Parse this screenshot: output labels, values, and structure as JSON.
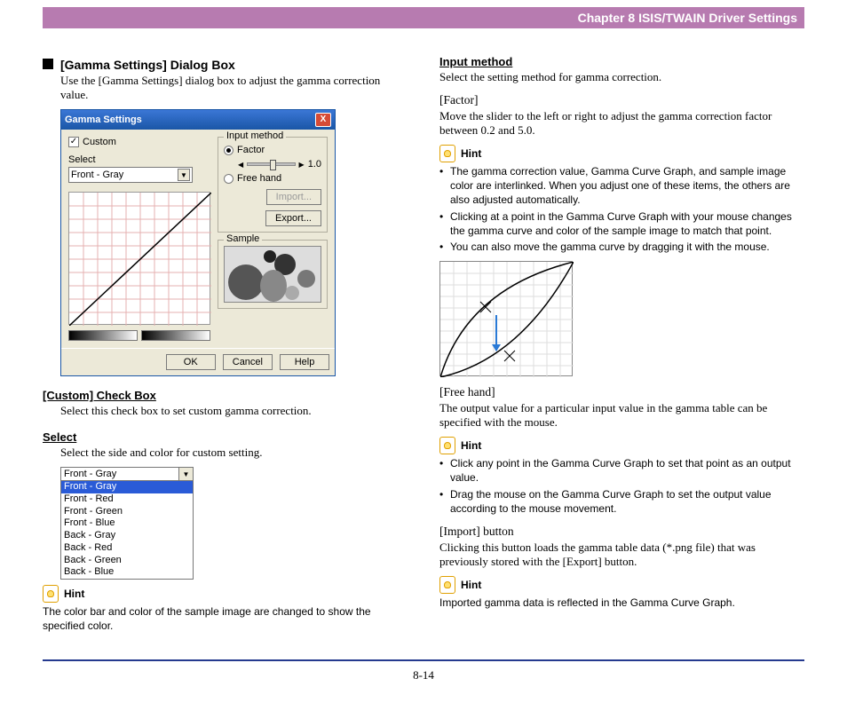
{
  "header": {
    "chapter": "Chapter 8   ISIS/TWAIN Driver Settings"
  },
  "left": {
    "h_main": "[Gamma Settings] Dialog Box",
    "intro": "Use the [Gamma Settings] dialog box to adjust the gamma correction value.",
    "dialog": {
      "title": "Gamma Settings",
      "close": "X",
      "custom_chk": "✓",
      "custom_label": "Custom",
      "select_label": "Select",
      "select_value": "Front - Gray",
      "input_method_legend": "Input method",
      "factor_label": "Factor",
      "freehand_label": "Free hand",
      "factor_value": "1.0",
      "import_btn": "Import...",
      "export_btn": "Export...",
      "sample_legend": "Sample",
      "ok": "OK",
      "cancel": "Cancel",
      "help": "Help"
    },
    "h_custom": "[Custom] Check Box",
    "custom_body": "Select this check box to set custom gamma correction.",
    "h_select": "Select",
    "select_body": "Select the side and color for custom setting.",
    "listbox": {
      "selected": "Front - Gray",
      "items": [
        "Front - Gray",
        "Front - Red",
        "Front - Green",
        "Front - Blue",
        "Back - Gray",
        "Back - Red",
        "Back - Green",
        "Back - Blue"
      ]
    },
    "hint_label": "Hint",
    "hint_body": "The color bar and color of the sample image are changed to show the specified color."
  },
  "right": {
    "h_input": "Input method",
    "input_body": "Select the setting method for gamma correction.",
    "h_factor": "[Factor]",
    "factor_body": "Move the slider to the left or right to adjust the gamma correction factor between 0.2 and 5.0.",
    "hint_label": "Hint",
    "hint1": [
      "The gamma correction value, Gamma Curve Graph, and sample image color are interlinked. When you adjust one of these items, the others are also adjusted automatically.",
      "Clicking at a point in the Gamma Curve Graph with your mouse changes the gamma curve and color of the sample image to match that point.",
      "You can also move the gamma curve by dragging it with the mouse."
    ],
    "h_freehand": "[Free hand]",
    "freehand_body": "The output value for a particular input value in the gamma table can be specified with the mouse.",
    "hint2": [
      "Click any point in the Gamma Curve Graph to set that point as an output value.",
      "Drag the mouse on the Gamma Curve Graph to set the output value according to the mouse movement."
    ],
    "h_import": "[Import] button",
    "import_body": "Clicking this button loads the gamma table data (*.png file) that was previously stored with the [Export] button.",
    "hint3": "Imported gamma data is reflected in the Gamma Curve Graph."
  },
  "footer": {
    "page": "8-14"
  }
}
